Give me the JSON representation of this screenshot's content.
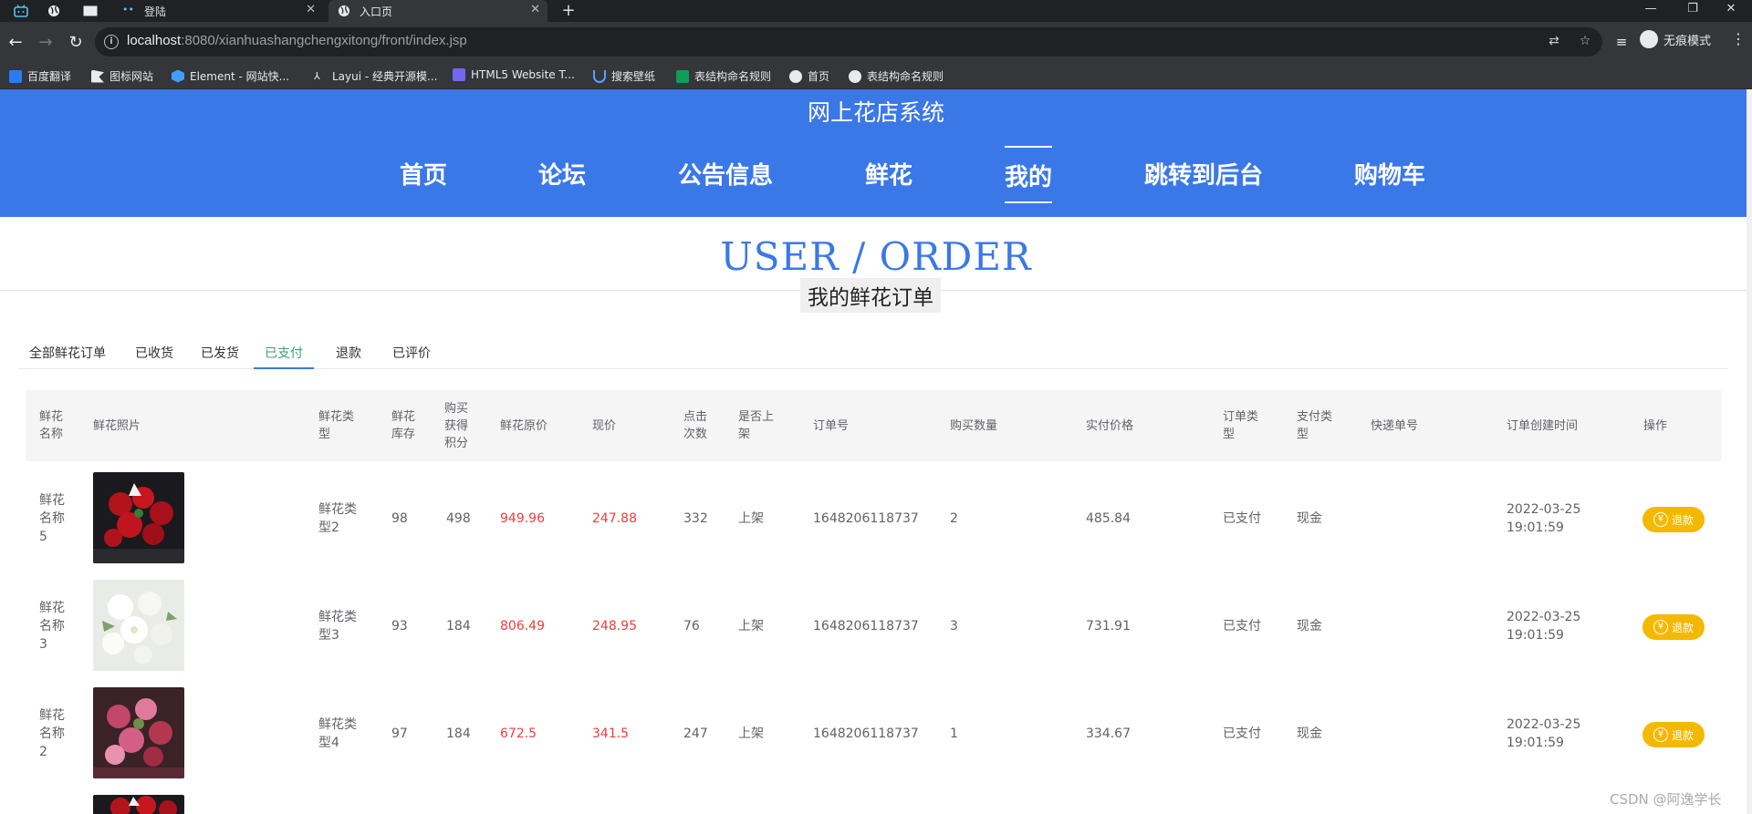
{
  "browser": {
    "tabs": [
      {
        "title": "登陆",
        "active": false
      },
      {
        "title": "入口页",
        "active": true
      }
    ],
    "url": {
      "host": "localhost",
      "rest": ":8080/xianhuashangchengxitong/front/index.jsp"
    },
    "incognito_label": "无痕模式",
    "bookmarks": [
      "百度翻译",
      "图标网站",
      "Element - 网站快...",
      "Layui - 经典开源模...",
      "HTML5 Website T...",
      "搜索壁纸",
      "表结构命名规则",
      "首页",
      "表结构命名规则"
    ]
  },
  "site": {
    "title": "网上花店系统"
  },
  "nav": [
    "首页",
    "论坛",
    "公告信息",
    "鲜花",
    "我的",
    "跳转到后台",
    "购物车"
  ],
  "nav_active": "我的",
  "section": {
    "title": "USER / ORDER",
    "subtitle": "我的鲜花订单"
  },
  "order_tabs": [
    "全部鲜花订单",
    "已收货",
    "已发货",
    "已支付",
    "退款",
    "已评价"
  ],
  "order_tab_active": "已支付",
  "table": {
    "headers": [
      "鲜花\n名称",
      "鲜花照片",
      "鲜花类\n型",
      "鲜花\n库存",
      "购买\n获得\n积分",
      "鲜花原价",
      "现价",
      "点击\n次数",
      "是否上\n架",
      "订单号",
      "购买数量",
      "实付价格",
      "订单类\n型",
      "支付类\n型",
      "快递单号",
      "订单创建时间",
      "操作"
    ],
    "rows": [
      {
        "name": "鲜花\n名称\n5",
        "type": "鲜花类\n型2",
        "stock": "98",
        "points": "498",
        "orig_price": "949.96",
        "price": "247.88",
        "clicks": "332",
        "shelf": "上架",
        "order_no": "1648206118737",
        "qty": "2",
        "paid": "485.84",
        "order_type": "已支付",
        "pay_type": "现金",
        "express": "",
        "created": "2022-03-25\n19:01:59",
        "action": "退款"
      },
      {
        "name": "鲜花\n名称\n3",
        "type": "鲜花类\n型3",
        "stock": "93",
        "points": "184",
        "orig_price": "806.49",
        "price": "248.95",
        "clicks": "76",
        "shelf": "上架",
        "order_no": "1648206118737",
        "qty": "3",
        "paid": "731.91",
        "order_type": "已支付",
        "pay_type": "现金",
        "express": "",
        "created": "2022-03-25\n19:01:59",
        "action": "退款"
      },
      {
        "name": "鲜花\n名称\n2",
        "type": "鲜花类\n型4",
        "stock": "97",
        "points": "184",
        "orig_price": "672.5",
        "price": "341.5",
        "clicks": "247",
        "shelf": "上架",
        "order_no": "1648206118737",
        "qty": "1",
        "paid": "334.67",
        "order_type": "已支付",
        "pay_type": "现金",
        "express": "",
        "created": "2022-03-25\n19:01:59",
        "action": "退款"
      }
    ]
  },
  "watermark": "CSDN @阿逸学长",
  "colors": {
    "header": "#3b78e7",
    "accent": "#3b78e7",
    "active_tab": "#37a085",
    "price_red": "#f23c3c",
    "refund_button": "#f5b800"
  }
}
